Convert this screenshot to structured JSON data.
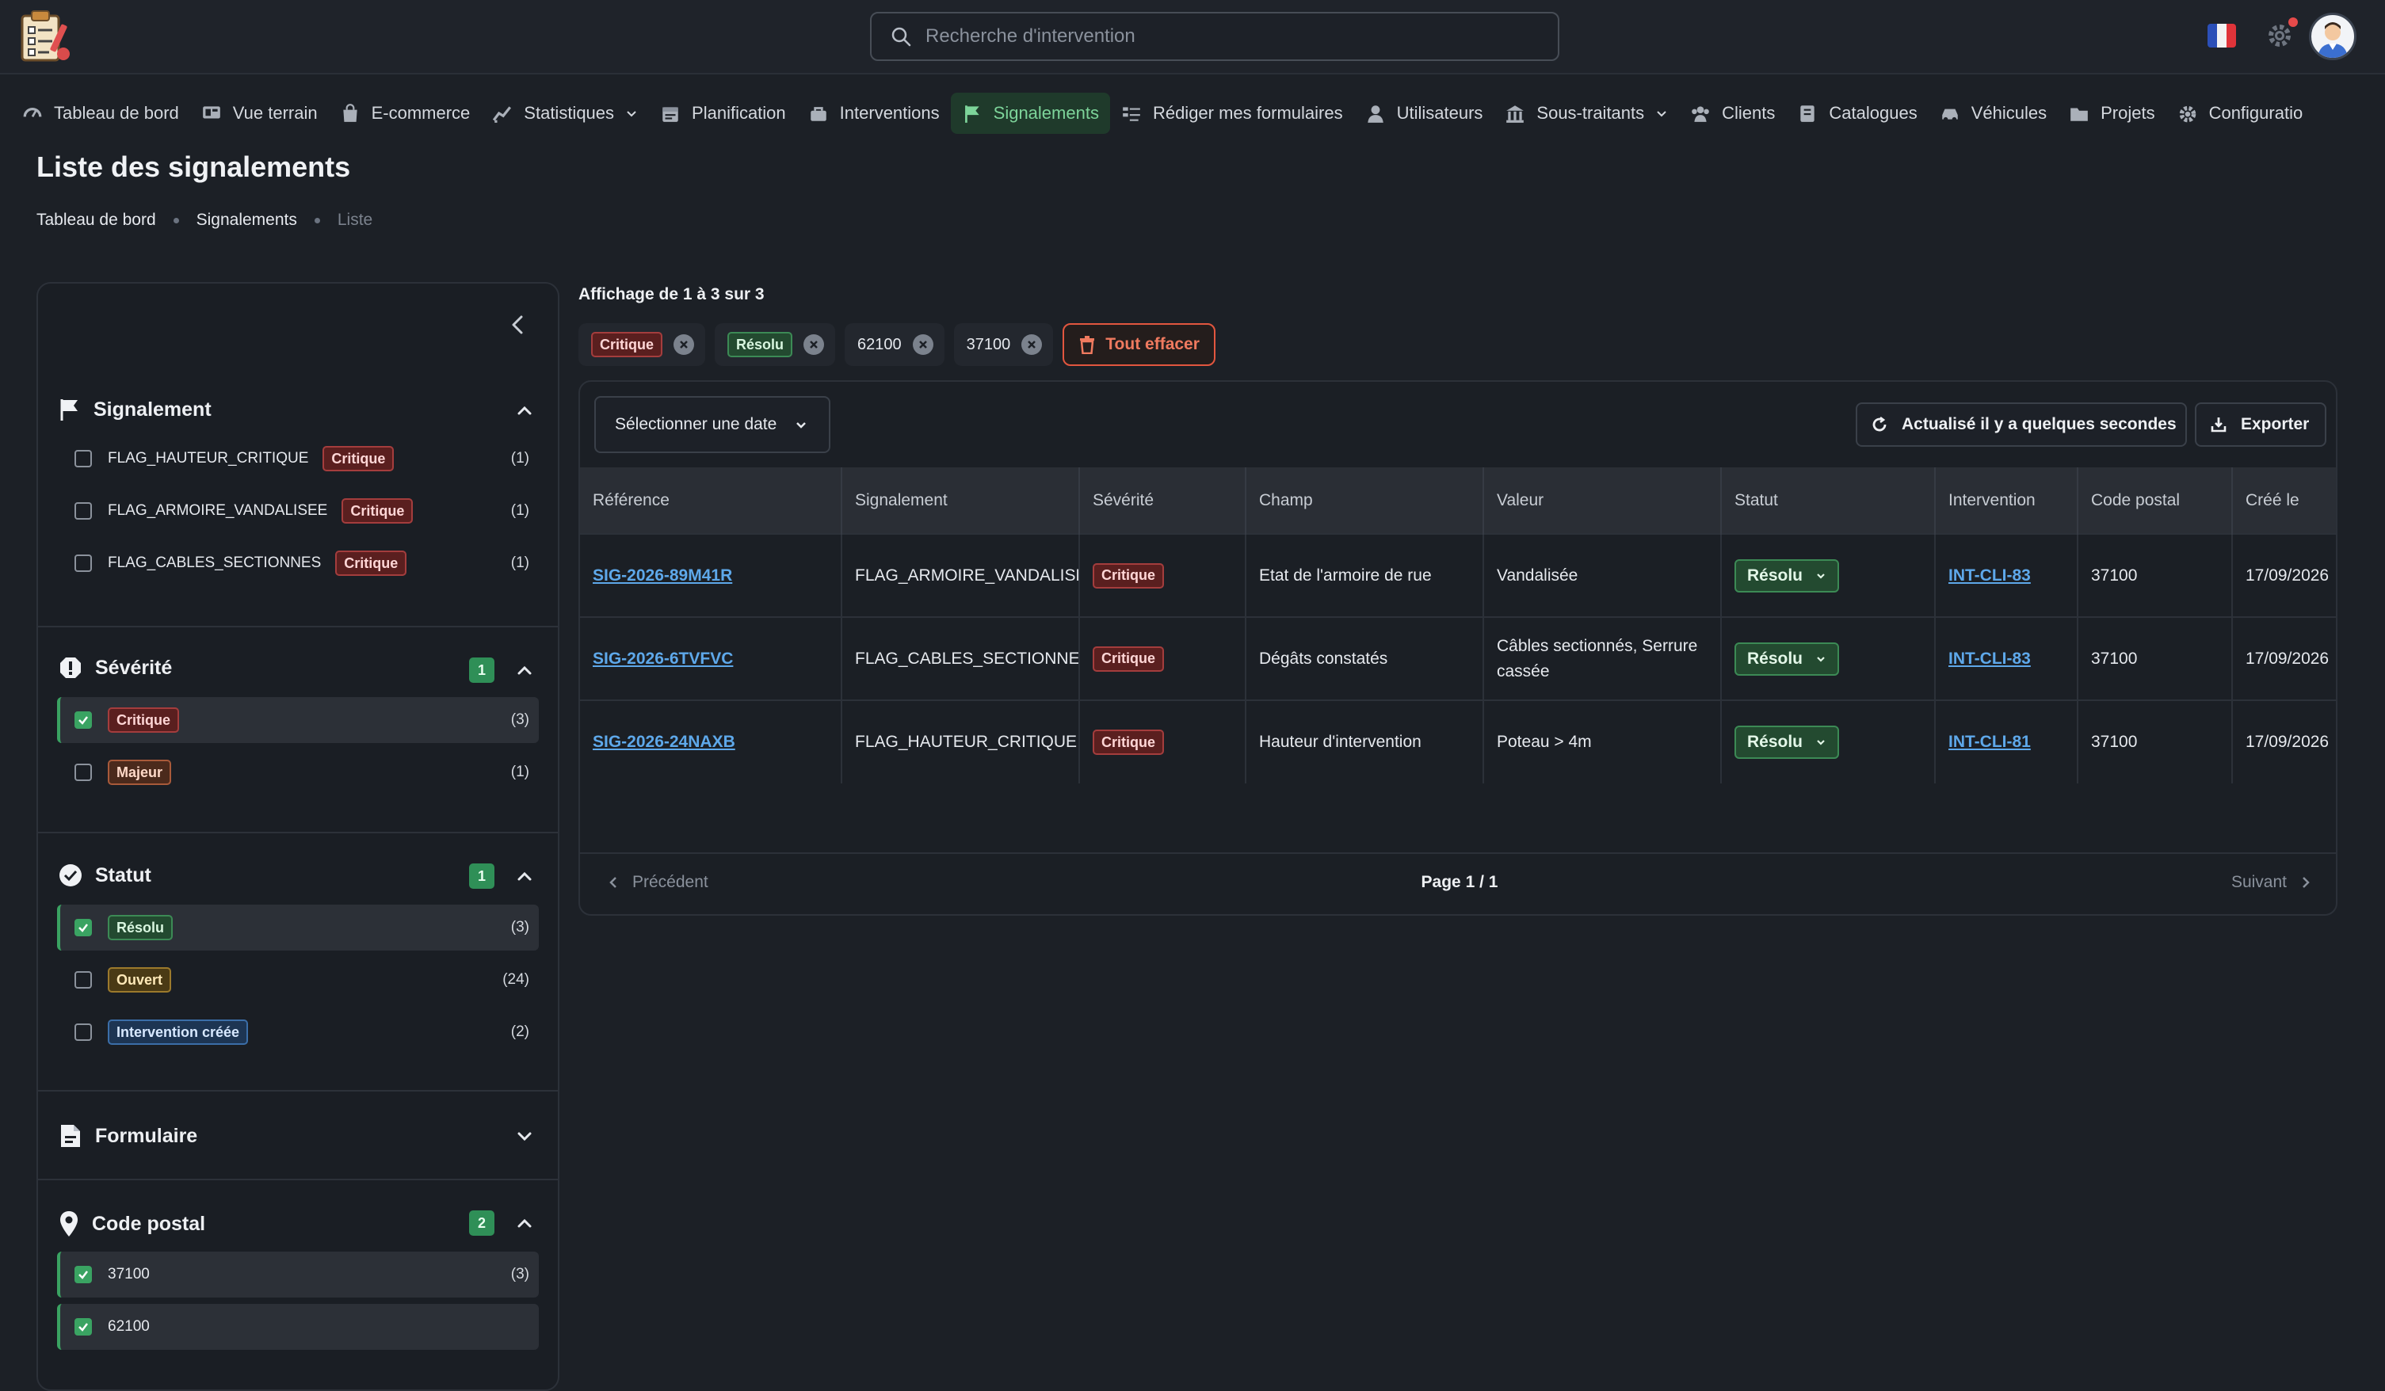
{
  "search": {
    "placeholder": "Recherche d'intervention"
  },
  "nav": [
    {
      "label": "Tableau de bord",
      "icon": "gauge-icon"
    },
    {
      "label": "Vue terrain",
      "icon": "map-view-icon"
    },
    {
      "label": "E-commerce",
      "icon": "shopping-bag-icon"
    },
    {
      "label": "Statistiques",
      "icon": "chart-icon"
    },
    {
      "label": "Planification",
      "icon": "calendar-icon"
    },
    {
      "label": "Interventions",
      "icon": "toolbox-icon"
    },
    {
      "label": "Signalements",
      "icon": "flag-icon"
    },
    {
      "label": "Rédiger mes formulaires",
      "icon": "form-icon"
    },
    {
      "label": "Utilisateurs",
      "icon": "user-icon"
    },
    {
      "label": "Sous-traitants",
      "icon": "building-icon"
    },
    {
      "label": "Clients",
      "icon": "group-icon"
    },
    {
      "label": "Catalogues",
      "icon": "book-icon"
    },
    {
      "label": "Véhicules",
      "icon": "car-icon"
    },
    {
      "label": "Projets",
      "icon": "folder-icon"
    },
    {
      "label": "Configuratio",
      "icon": "gear-icon"
    }
  ],
  "page": {
    "title": "Liste des signalements"
  },
  "breadcrumb": [
    "Tableau de bord",
    "Signalements",
    "Liste"
  ],
  "filters": {
    "signalement": {
      "title": "Signalement",
      "options": [
        {
          "label": "FLAG_HAUTEUR_CRITIQUE",
          "badge": "Critique",
          "count": "(1)"
        },
        {
          "label": "FLAG_ARMOIRE_VANDALISEE",
          "badge": "Critique",
          "count": "(1)"
        },
        {
          "label": "FLAG_CABLES_SECTIONNES",
          "badge": "Critique",
          "count": "(1)"
        }
      ]
    },
    "severite": {
      "title": "Sévérité",
      "selected_count": "1",
      "options": [
        {
          "badge": "Critique",
          "count": "(3)",
          "checked": true
        },
        {
          "badge": "Majeur",
          "count": "(1)",
          "checked": false
        }
      ]
    },
    "statut": {
      "title": "Statut",
      "selected_count": "1",
      "options": [
        {
          "badge": "Résolu",
          "count": "(3)",
          "checked": true
        },
        {
          "badge": "Ouvert",
          "count": "(24)",
          "checked": false
        },
        {
          "badge": "Intervention créée",
          "count": "(2)",
          "checked": false
        }
      ]
    },
    "formulaire": {
      "title": "Formulaire"
    },
    "code_postal": {
      "title": "Code postal",
      "selected_count": "2",
      "options": [
        {
          "label": "37100",
          "count": "(3)",
          "checked": true
        },
        {
          "label": "62100",
          "count": "",
          "checked": true
        }
      ]
    }
  },
  "results": {
    "summary": "Affichage de 1 à 3 sur 3"
  },
  "active_filters": {
    "chips": [
      "Critique",
      "Résolu",
      "62100",
      "37100"
    ],
    "clear_label": "Tout effacer"
  },
  "toolbar": {
    "date_label": "Sélectionner une date",
    "refresh_label": "Actualisé il y a quelques secondes",
    "export_label": "Exporter"
  },
  "table": {
    "columns": [
      "Référence",
      "Signalement",
      "Sévérité",
      "Champ",
      "Valeur",
      "Statut",
      "Intervention",
      "Code postal",
      "Créé le"
    ],
    "rows": [
      {
        "ref": "SIG-2026-89M41R",
        "signalement": "FLAG_ARMOIRE_VANDALISEE",
        "severite": "Critique",
        "champ": "Etat de l'armoire de rue",
        "valeur": "Vandalisée",
        "statut": "Résolu",
        "intervention": "INT-CLI-83",
        "code_postal": "37100",
        "cree_le": "17/09/2026"
      },
      {
        "ref": "SIG-2026-6TVFVC",
        "signalement": "FLAG_CABLES_SECTIONNES",
        "severite": "Critique",
        "champ": "Dégâts constatés",
        "valeur": "Câbles sectionnés, Serrure cassée",
        "statut": "Résolu",
        "intervention": "INT-CLI-83",
        "code_postal": "37100",
        "cree_le": "17/09/2026"
      },
      {
        "ref": "SIG-2026-24NAXB",
        "signalement": "FLAG_HAUTEUR_CRITIQUE",
        "severite": "Critique",
        "champ": "Hauteur d'intervention",
        "valeur": "Poteau > 4m",
        "statut": "Résolu",
        "intervention": "INT-CLI-81",
        "code_postal": "37100",
        "cree_le": "17/09/2026"
      }
    ]
  },
  "pagination": {
    "prev": "Précédent",
    "page": "Page 1 / 1",
    "next": "Suivant"
  },
  "colors": {
    "accent": "#3aa362",
    "danger": "#e2563f",
    "link": "#5ea8ea"
  }
}
